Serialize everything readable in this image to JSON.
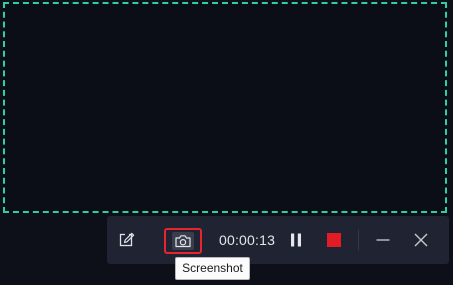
{
  "recording": {
    "timer": "00:00:13"
  },
  "toolbar": {
    "buttons": [
      {
        "name": "edit",
        "icon": "pencil-edit-icon"
      },
      {
        "name": "screenshot",
        "icon": "camera-icon"
      },
      {
        "name": "pause",
        "icon": "pause-icon"
      },
      {
        "name": "stop",
        "icon": "stop-icon"
      },
      {
        "name": "minimize",
        "icon": "minimize-icon"
      },
      {
        "name": "close",
        "icon": "close-icon"
      }
    ]
  },
  "tooltip": {
    "text": "Screenshot"
  },
  "colors": {
    "capture_border": "#2fcf9f",
    "highlight": "#e8252f",
    "stop": "#e21b25",
    "toolbar_bg": "#202331",
    "background": "#0e1019"
  }
}
